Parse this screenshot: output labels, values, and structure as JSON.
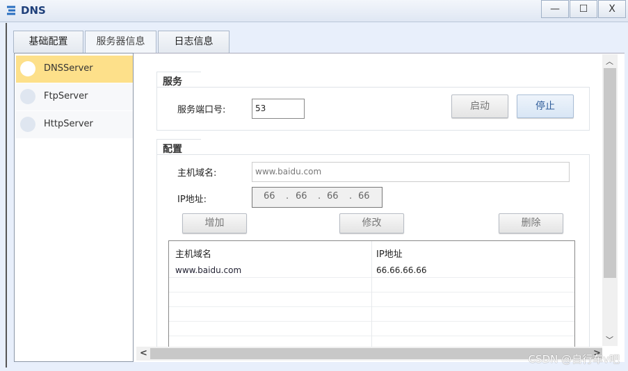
{
  "window": {
    "title": "DNS",
    "minimize": "—",
    "maximize": "☐",
    "close": "X"
  },
  "tabs": [
    {
      "label": "基础配置"
    },
    {
      "label": "服务器信息",
      "active": true
    },
    {
      "label": "日志信息"
    }
  ],
  "servers": [
    {
      "label": "DNSServer",
      "selected": true
    },
    {
      "label": "FtpServer"
    },
    {
      "label": "HttpServer"
    }
  ],
  "service": {
    "group_title": "服务",
    "port_label": "服务端口号:",
    "port_value": "53",
    "start_label": "启动",
    "stop_label": "停止"
  },
  "config": {
    "group_title": "配置",
    "host_label": "主机域名:",
    "host_value": "www.baidu.com",
    "ip_label": "IP地址:",
    "ip": [
      "66",
      "66",
      "66",
      "66"
    ],
    "add_label": "增加",
    "modify_label": "修改",
    "delete_label": "删除"
  },
  "table": {
    "headers": [
      "主机域名",
      "IP地址"
    ],
    "rows": [
      [
        "www.baidu.com",
        "66.66.66.66"
      ]
    ]
  },
  "scroll": {
    "up": "︿",
    "down": "﹀",
    "left": "<",
    "right": ">"
  },
  "watermark": "CSDN @自行车v吧",
  "colors": {
    "selected": "#fde08a",
    "title": "#1e3f7a"
  }
}
